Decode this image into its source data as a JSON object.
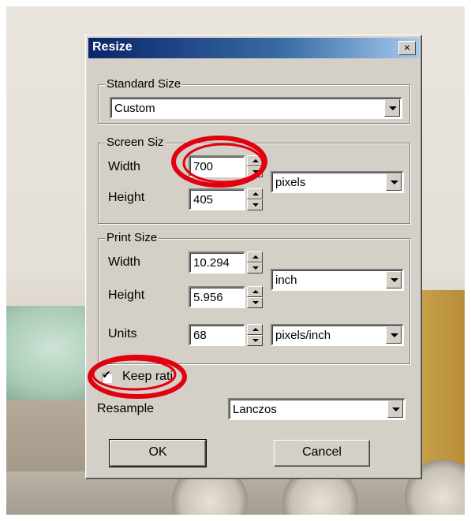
{
  "dialog": {
    "title": "Resize",
    "close_glyph": "×"
  },
  "standard_size": {
    "legend": "Standard Size",
    "selected": "Custom"
  },
  "screen_size": {
    "legend": "Screen Siz",
    "width_label": "Width",
    "width_value": "700",
    "height_label": "Height",
    "height_value": "405",
    "unit_selected": "pixels"
  },
  "print_size": {
    "legend": "Print Size",
    "width_label": "Width",
    "width_value": "10.294",
    "height_label": "Height",
    "height_value": "5.956",
    "unit_selected": "inch",
    "units_label": "Units",
    "units_value": "68",
    "units_unit_selected": "pixels/inch"
  },
  "keep_ratio": {
    "label": "Keep rati",
    "checked": true
  },
  "resample": {
    "label": "Resample",
    "selected": "Lanczos"
  },
  "buttons": {
    "ok": "OK",
    "cancel": "Cancel"
  },
  "annotations": {
    "color": "#e3000f"
  },
  "icons": {
    "close": "close-icon",
    "dropdown": "chevron-down-icon",
    "spin_up": "spin-up-icon",
    "spin_down": "spin-down-icon",
    "check": "checkmark-icon"
  }
}
